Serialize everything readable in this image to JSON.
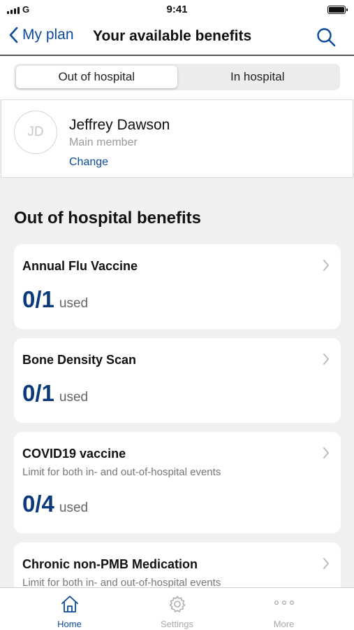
{
  "status_bar": {
    "carrier": "G",
    "time": "9:41"
  },
  "nav": {
    "back_label": "My plan",
    "title": "Your available benefits"
  },
  "tabs_segment": [
    {
      "label": "Out of hospital",
      "active": true
    },
    {
      "label": "In hospital",
      "active": false
    }
  ],
  "member": {
    "initials": "JD",
    "name": "Jeffrey Dawson",
    "role": "Main member",
    "change_label": "Change"
  },
  "section_title": "Out of hospital benefits",
  "benefits": [
    {
      "title": "Annual Flu Vaccine",
      "subtitle": "",
      "usage": "0/1",
      "usage_label": "used"
    },
    {
      "title": "Bone Density Scan",
      "subtitle": "",
      "usage": "0/1",
      "usage_label": "used"
    },
    {
      "title": "COVID19 vaccine",
      "subtitle": "Limit for both in- and out-of-hospital events",
      "usage": "0/4",
      "usage_label": "used"
    },
    {
      "title": "Chronic non-PMB Medication",
      "subtitle": "Limit for both in- and out-of-hospital events",
      "usage": "",
      "usage_label": ""
    }
  ],
  "tab_bar": [
    {
      "label": "Home",
      "icon": "home-icon",
      "active": true
    },
    {
      "label": "Settings",
      "icon": "gear-icon",
      "active": false
    },
    {
      "label": "More",
      "icon": "more-icon",
      "active": false
    }
  ],
  "colors": {
    "accent": "#0b4a9c",
    "usage": "#0b3a7a",
    "background": "#f0f0f0"
  }
}
